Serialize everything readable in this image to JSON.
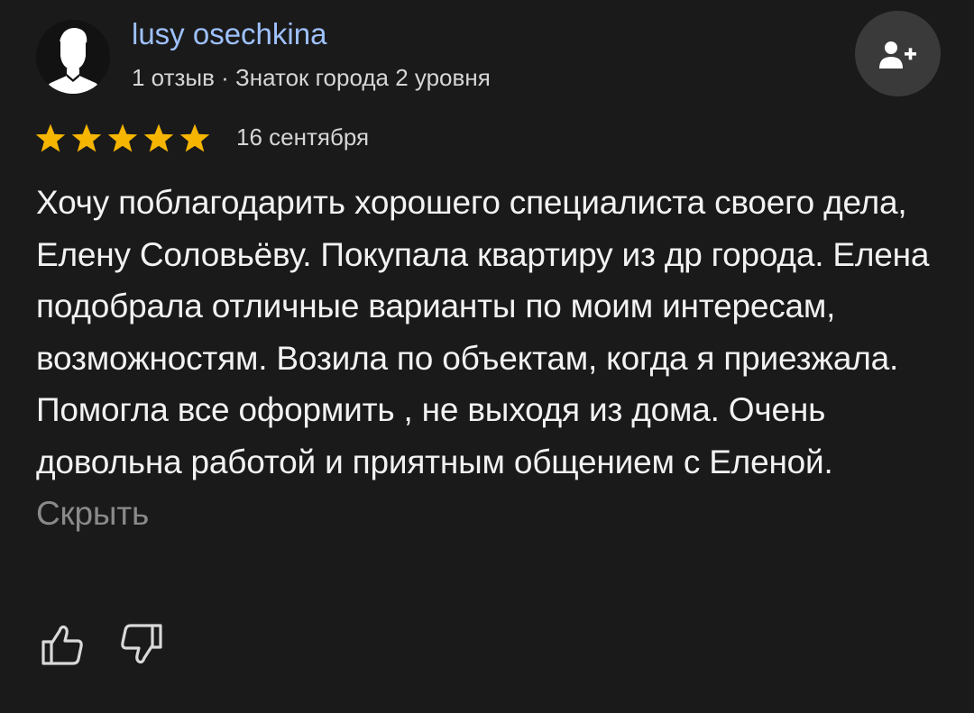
{
  "author": {
    "name": "lusy osechkina",
    "meta": "1 отзыв · Знаток города 2 уровня",
    "avatar_icon": "user-silhouette-icon"
  },
  "subscribe": {
    "icon": "add-user-icon"
  },
  "review": {
    "rating": 5,
    "max_rating": 5,
    "date": "16 сентября",
    "text": "Хочу поблагодарить хорошего специалиста своего дела, Елену Соловьёву. Покупала квартиру из др города. Елена подобрала отличные варианты по моим интересам, возможностям. Возила по объектам, когда я приезжала. Помогла все оформить , не выходя из дома. Очень довольна работой и приятным общением с Еленой.",
    "collapse_label": "Скрыть"
  },
  "reactions": {
    "like_icon": "thumbs-up-icon",
    "dislike_icon": "thumbs-down-icon"
  },
  "colors": {
    "background": "#1a1a1a",
    "author_name": "#9ec1ff",
    "star": "#f6b500",
    "muted_text": "#8a8a8a"
  }
}
